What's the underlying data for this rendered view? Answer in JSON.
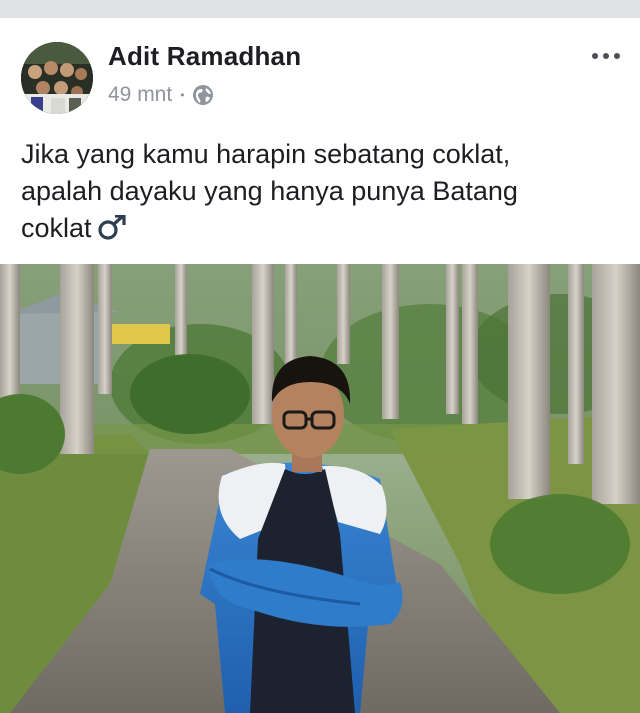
{
  "post": {
    "author": "Adit Ramadhan",
    "time": "49 mnt",
    "separator": "•",
    "privacy_icon": "globe-icon",
    "menu_icon": "more-options-icon",
    "text_lines": [
      "Jika yang kamu harapin sebatang coklat,",
      "apalah dayaku yang hanya punya Batang",
      "coklat"
    ],
    "emoji_icon": "male-sign-icon"
  },
  "colors": {
    "author": "#1c1e21",
    "meta": "#90949c",
    "emoji": "#2c3e50",
    "topbar": "#dfe1e4"
  }
}
